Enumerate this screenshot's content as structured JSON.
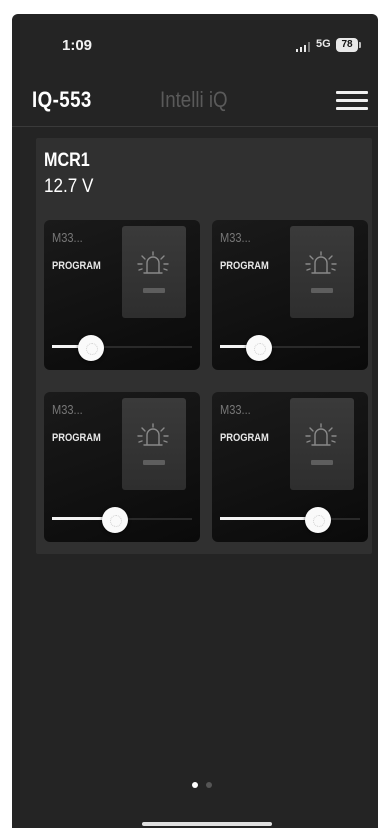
{
  "status_bar": {
    "time": "1:09",
    "network": "5G",
    "battery": "78"
  },
  "header": {
    "device_id": "IQ-553",
    "app_title": "Intelli iQ",
    "menu_icon": "hamburger-menu-icon"
  },
  "group": {
    "name": "MCR1",
    "voltage": "12.7 V",
    "channels": [
      {
        "id": "M33...",
        "mode": "PROGRAM",
        "icon": "beacon-light-icon",
        "level": 0.28
      },
      {
        "id": "M33...",
        "mode": "PROGRAM",
        "icon": "beacon-light-icon",
        "level": 0.28
      },
      {
        "id": "M33...",
        "mode": "PROGRAM",
        "icon": "beacon-light-icon",
        "level": 0.45
      },
      {
        "id": "M33...",
        "mode": "PROGRAM",
        "icon": "beacon-light-icon",
        "level": 0.7
      }
    ]
  },
  "pager": {
    "pages": 2,
    "current": 0,
    "active_color": "#ffffff",
    "inactive_color": "#555555"
  },
  "colors": {
    "background": "#242424",
    "panel": "#303030",
    "card": "#0f0f0f",
    "accent": "#ffffff"
  }
}
